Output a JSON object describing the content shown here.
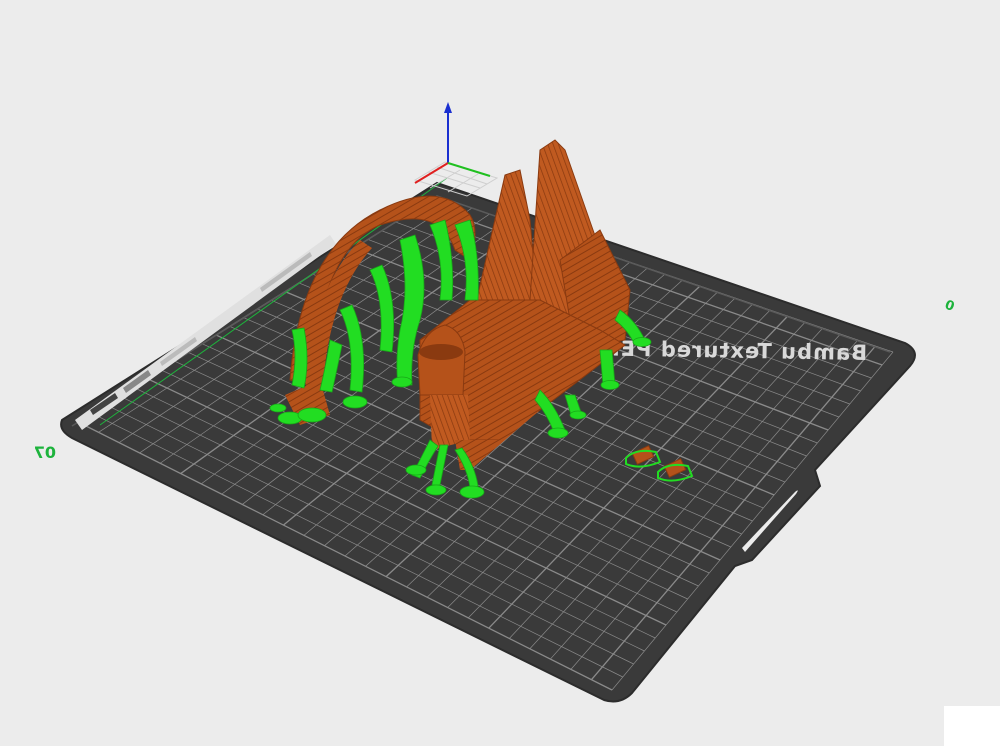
{
  "viewport": {
    "plate_label": "Bambu Textured PEI Pla",
    "axis_label_left": "07",
    "axis_label_right": "0"
  },
  "colors": {
    "background": "#ececec",
    "plate": "#3a3a3a",
    "grid": "#8a8a8a",
    "model": "#b5521a",
    "model_dark": "#8a3a10",
    "support": "#22dd22",
    "z_axis": "#1a2fd0",
    "x_axis": "#e02020",
    "y_axis": "#20c020"
  },
  "icons": [
    "axis-gizmo-icon"
  ]
}
